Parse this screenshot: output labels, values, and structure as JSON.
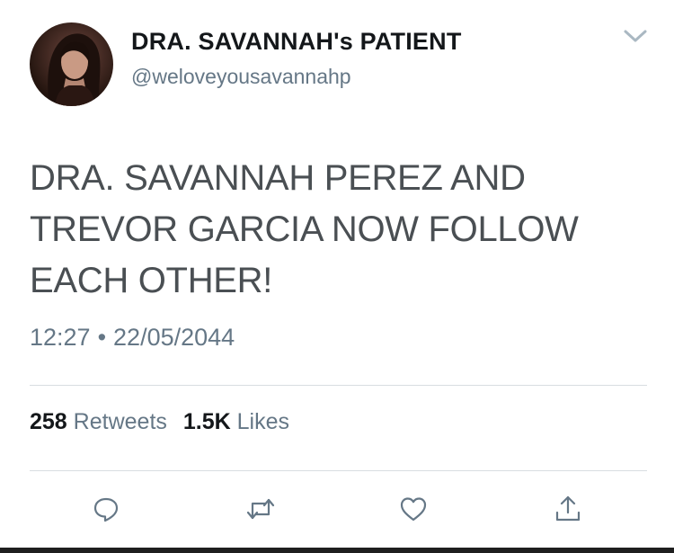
{
  "tweet": {
    "display_name": "DRA. SAVANNAH's PATIENT",
    "handle": "@weloveyousavannahp",
    "text": "DRA. SAVANNAH PEREZ AND TREVOR GARCIA NOW FOLLOW EACH OTHER!",
    "time": "12:27",
    "separator": "•",
    "date": "22/05/2044"
  },
  "stats": {
    "retweets_count": "258",
    "retweets_label": "Retweets",
    "likes_count": "1.5K",
    "likes_label": "Likes"
  },
  "icons": {
    "menu": "chevron-down-icon",
    "actions": [
      "reply-icon",
      "retweet-icon",
      "like-icon",
      "share-icon"
    ]
  },
  "colors": {
    "secondary_text": "#657786",
    "primary_text": "#14171a",
    "divider": "#d8dde1"
  }
}
